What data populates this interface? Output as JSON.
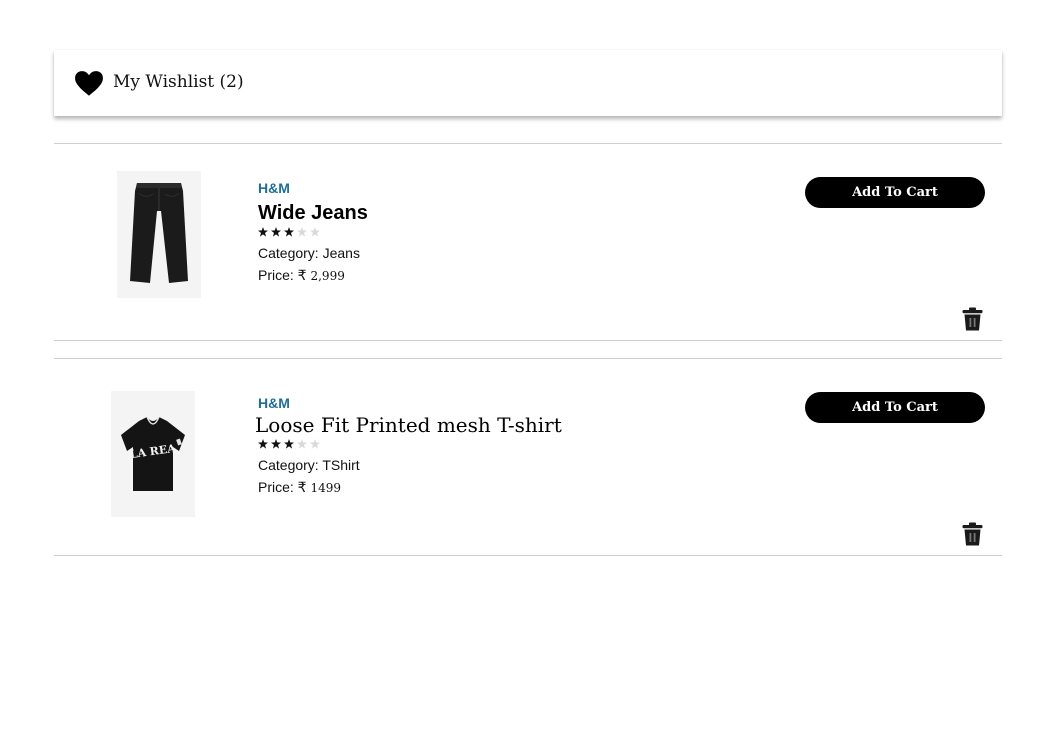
{
  "header": {
    "icon": "heart-icon",
    "title": "My Wishlist (2)"
  },
  "items": [
    {
      "brand": "H&M",
      "name": "Wide Jeans",
      "rating": 3,
      "rating_max": 5,
      "category": "Category: Jeans",
      "price_label": "Price: ₹",
      "price_value": "2,999",
      "add_to_cart_label": "Add To Cart",
      "image_icon": "jeans-image",
      "delete_icon": "trash-icon"
    },
    {
      "brand": "H&M",
      "name": "Loose Fit Printed mesh T-shirt",
      "rating": 3,
      "rating_max": 5,
      "category": "Category: TShirt",
      "price_label": "Price: ₹",
      "price_value": "1499",
      "add_to_cart_label": "Add To Cart",
      "image_icon": "tshirt-image",
      "delete_icon": "trash-icon"
    }
  ],
  "colors": {
    "brand": "#1f6f95",
    "button_bg": "#000000",
    "button_text": "#ffffff",
    "star_filled": "#111111",
    "star_empty": "#d9d9d9",
    "divider": "#cfcfcf"
  }
}
